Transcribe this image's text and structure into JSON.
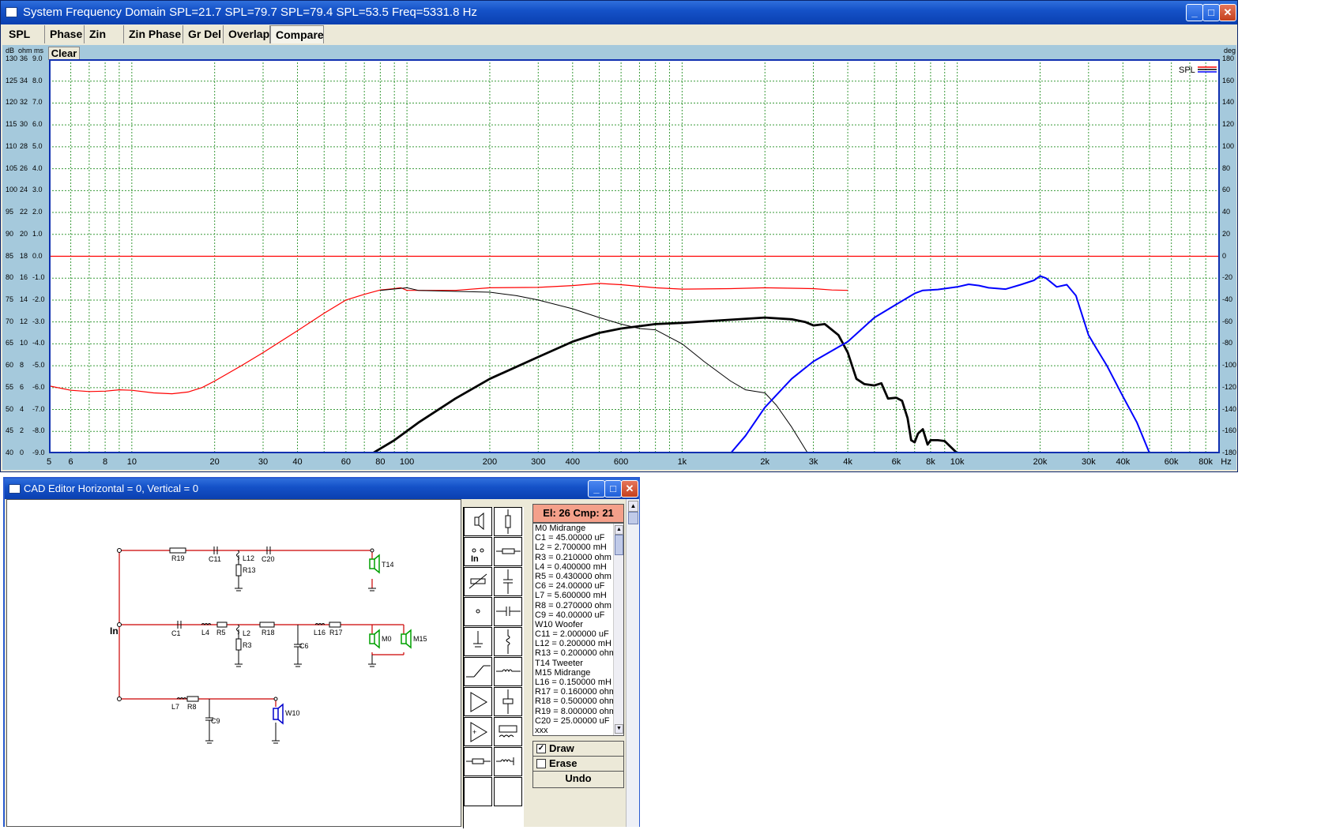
{
  "freq_window": {
    "title": "System Frequency Domain  SPL=21.7  SPL=79.7  SPL=79.4  SPL=53.5    Freq=5331.8 Hz",
    "tabs": [
      "SPL",
      "Phase",
      "Zin",
      "Zin Phase",
      "Gr Del",
      "Overlap",
      "Compare"
    ],
    "active_tab": "Compare",
    "clear_label": "Clear",
    "left_axis_headers": {
      "db": "dB",
      "ohm": "ohm",
      "ms": "ms"
    },
    "right_axis_header": "deg",
    "legend_label": "SPL",
    "x_unit": "Hz"
  },
  "chart_data": {
    "type": "line",
    "x_scale": "log",
    "xlim": [
      5,
      90000
    ],
    "ylim": [
      40,
      130
    ],
    "y_axes": {
      "db": [
        "130",
        "125",
        "120",
        "115",
        "110",
        "105",
        "100",
        "95",
        "90",
        "85",
        "80",
        "75",
        "70",
        "65",
        "60",
        "55",
        "50",
        "45",
        "40"
      ],
      "ohm": [
        "36",
        "34",
        "32",
        "30",
        "28",
        "26",
        "24",
        "22",
        "20",
        "18",
        "16",
        "14",
        "12",
        "10",
        "8",
        "6",
        "4",
        "2",
        "0"
      ],
      "ms": [
        "9.0",
        "8.0",
        "7.0",
        "6.0",
        "5.0",
        "4.0",
        "3.0",
        "2.0",
        "1.0",
        "0.0",
        "-1.0",
        "-2.0",
        "-3.0",
        "-4.0",
        "-5.0",
        "-6.0",
        "-7.0",
        "-8.0",
        "-9.0"
      ],
      "deg": [
        "180",
        "160",
        "140",
        "120",
        "100",
        "80",
        "60",
        "40",
        "20",
        "0",
        "-20",
        "-40",
        "-60",
        "-80",
        "-100",
        "-120",
        "-140",
        "-160",
        "-180"
      ]
    },
    "x_ticks": [
      "5",
      "6",
      "8",
      "10",
      "20",
      "30",
      "40",
      "60",
      "80",
      "100",
      "200",
      "300",
      "400",
      "600",
      "1k",
      "2k",
      "3k",
      "4k",
      "6k",
      "8k",
      "10k",
      "20k",
      "30k",
      "40k",
      "60k",
      "80k"
    ],
    "x_tick_values": [
      5,
      6,
      8,
      10,
      20,
      30,
      40,
      60,
      80,
      100,
      200,
      300,
      400,
      600,
      1000,
      2000,
      3000,
      4000,
      6000,
      8000,
      10000,
      20000,
      30000,
      40000,
      60000,
      80000
    ],
    "grid": true,
    "legend_position": "top-right",
    "series": [
      {
        "color": "#ff0000",
        "width": 1.2,
        "points": [
          [
            5,
            55.4
          ],
          [
            6,
            54.4
          ],
          [
            7,
            54.1
          ],
          [
            8,
            54.2
          ],
          [
            9,
            54.5
          ],
          [
            10,
            54.4
          ],
          [
            12,
            53.8
          ],
          [
            14,
            53.6
          ],
          [
            16,
            54
          ],
          [
            18,
            55
          ],
          [
            20,
            56.5
          ],
          [
            25,
            60
          ],
          [
            30,
            63
          ],
          [
            40,
            68
          ],
          [
            50,
            72
          ],
          [
            60,
            75
          ],
          [
            70,
            76.3
          ],
          [
            80,
            77.3
          ],
          [
            90,
            77.6
          ],
          [
            95,
            77.8
          ],
          [
            100,
            77.2
          ],
          [
            150,
            77.2
          ],
          [
            200,
            77.8
          ],
          [
            300,
            77.9
          ],
          [
            400,
            78.3
          ],
          [
            500,
            78.8
          ],
          [
            600,
            78.5
          ],
          [
            800,
            77.8
          ],
          [
            1000,
            77.5
          ],
          [
            1500,
            77.6
          ],
          [
            2000,
            77.8
          ],
          [
            3000,
            77.6
          ],
          [
            3500,
            77.3
          ],
          [
            4000,
            77.2
          ]
        ]
      },
      {
        "color": "#000000",
        "width": 1.0,
        "points": [
          [
            80,
            77.2
          ],
          [
            100,
            77.8
          ],
          [
            110,
            77.2
          ],
          [
            200,
            76.8
          ],
          [
            250,
            76
          ],
          [
            300,
            75
          ],
          [
            400,
            73
          ],
          [
            500,
            71
          ],
          [
            600,
            69.5
          ],
          [
            700,
            68.5
          ],
          [
            800,
            68.2
          ],
          [
            1000,
            65
          ],
          [
            1200,
            61
          ],
          [
            1500,
            56.5
          ],
          [
            1700,
            54.5
          ],
          [
            2000,
            53.8
          ],
          [
            2200,
            51
          ],
          [
            2500,
            46
          ],
          [
            2800,
            41
          ],
          [
            3000,
            38
          ]
        ]
      },
      {
        "color": "#000000",
        "width": 2.8,
        "points": [
          [
            75,
            40
          ],
          [
            90,
            43
          ],
          [
            110,
            47
          ],
          [
            150,
            52.5
          ],
          [
            200,
            57
          ],
          [
            300,
            62
          ],
          [
            400,
            65.5
          ],
          [
            500,
            67.5
          ],
          [
            600,
            68.5
          ],
          [
            800,
            69.5
          ],
          [
            1000,
            69.8
          ],
          [
            1500,
            70.5
          ],
          [
            2000,
            71
          ],
          [
            2500,
            70.6
          ],
          [
            2800,
            70
          ],
          [
            3000,
            69.2
          ],
          [
            3300,
            69.5
          ],
          [
            3700,
            67
          ],
          [
            4000,
            63
          ],
          [
            4300,
            57
          ],
          [
            4600,
            55.8
          ],
          [
            5000,
            55.5
          ],
          [
            5300,
            56
          ],
          [
            5600,
            52.5
          ],
          [
            6000,
            52.7
          ],
          [
            6300,
            52
          ],
          [
            6600,
            48
          ],
          [
            6800,
            43
          ],
          [
            7000,
            42.5
          ],
          [
            7200,
            44.5
          ],
          [
            7500,
            45.5
          ],
          [
            7800,
            42
          ],
          [
            8000,
            43
          ],
          [
            8500,
            43
          ],
          [
            9000,
            42.8
          ],
          [
            10000,
            40
          ]
        ]
      },
      {
        "color": "#0000ff",
        "width": 2.0,
        "points": [
          [
            5,
            40
          ],
          [
            1500,
            40
          ],
          [
            1700,
            44
          ],
          [
            2000,
            50.5
          ],
          [
            2500,
            57
          ],
          [
            3000,
            61
          ],
          [
            4000,
            65.5
          ],
          [
            5000,
            71
          ],
          [
            6000,
            74
          ],
          [
            7000,
            76.5
          ],
          [
            7500,
            77.2
          ],
          [
            8500,
            77.4
          ],
          [
            10000,
            78
          ],
          [
            11000,
            78.6
          ],
          [
            12000,
            78.3
          ],
          [
            13000,
            77.8
          ],
          [
            15000,
            77.5
          ],
          [
            17000,
            78.5
          ],
          [
            19000,
            79.5
          ],
          [
            20000,
            80.5
          ],
          [
            21000,
            80
          ],
          [
            23000,
            78
          ],
          [
            25000,
            78.5
          ],
          [
            27000,
            76
          ],
          [
            30000,
            67
          ],
          [
            32000,
            64
          ],
          [
            35000,
            60
          ],
          [
            40000,
            53
          ],
          [
            45000,
            47
          ],
          [
            50000,
            40
          ]
        ]
      }
    ],
    "reference_line": {
      "color": "#ff0000",
      "y": 85
    }
  },
  "cad_window": {
    "title": "CAD Editor  Horizontal = 0,  Vertical = 0",
    "el_count": "El: 26 Cmp: 21",
    "elements": [
      "M0 Midrange",
      "C1 = 45.00000 uF",
      "L2 = 2.700000 mH",
      "R3 = 0.210000 ohm",
      "L4 = 0.400000 mH",
      "R5 = 0.430000 ohm",
      "C6 = 24.00000 uF",
      "L7 = 5.600000 mH",
      "R8 = 0.270000 ohm",
      "C9 = 40.00000 uF",
      "W10 Woofer",
      "C11 = 2.000000 uF",
      "L12 = 0.200000 mH",
      "R13 = 0.200000 ohm",
      "T14 Tweeter",
      "M15 Midrange",
      "L16 = 0.150000 mH",
      "R17 = 0.160000 ohm",
      "R18 = 0.500000 ohm",
      "R19 = 8.000000 ohm",
      "C20 = 25.00000 uF",
      "xxx"
    ],
    "draw_label": "Draw",
    "erase_label": "Erase",
    "undo_label": "Undo",
    "palette_in_label": "In",
    "schematic": {
      "in_label": "In",
      "top_labels": {
        "r19": "R19",
        "c11": "C11",
        "l12": "L12",
        "r13": "R13",
        "c20": "C20",
        "t14": "T14"
      },
      "mid_labels": {
        "c1": "C1",
        "l4": "L4",
        "r5": "R5",
        "l2": "L2",
        "r3": "R3",
        "r18": "R18",
        "c6": "C6",
        "l16": "L16",
        "r17": "R17",
        "m0": "M0",
        "m15": "M15"
      },
      "bot_labels": {
        "l7": "L7",
        "r8": "R8",
        "c9": "C9",
        "w10": "W10"
      }
    }
  }
}
